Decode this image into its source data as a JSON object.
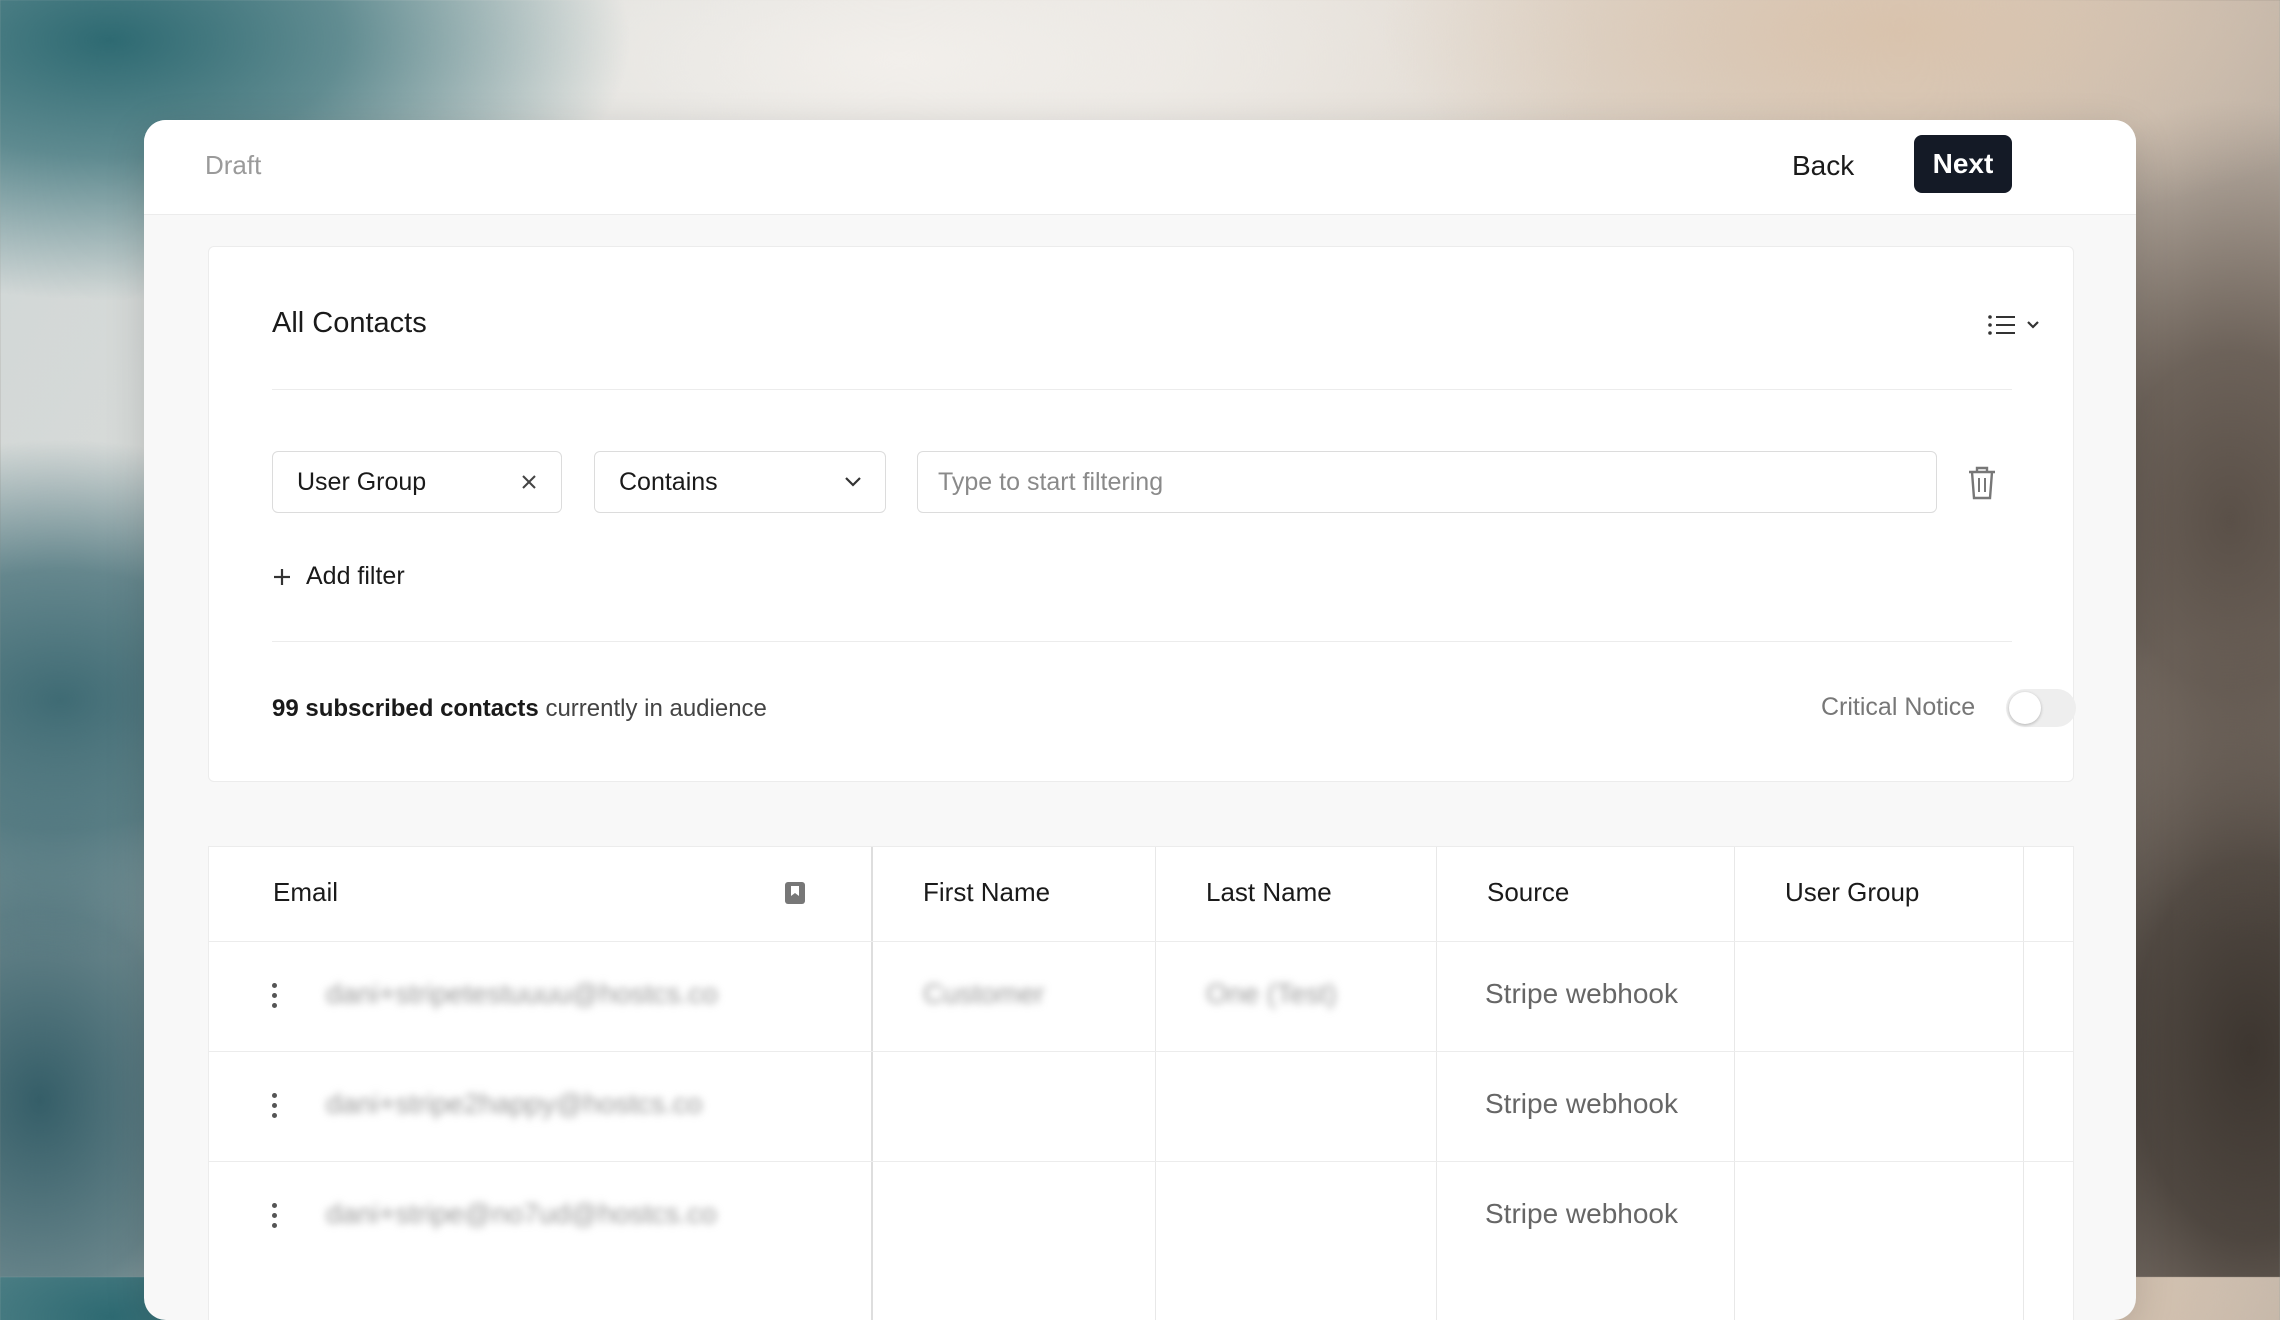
{
  "header": {
    "status": "Draft",
    "back_label": "Back",
    "next_label": "Next"
  },
  "audience": {
    "title": "All Contacts",
    "filter": {
      "field": "User Group",
      "operator": "Contains",
      "value_placeholder": "Type to start filtering"
    },
    "add_filter_label": "Add filter",
    "summary": {
      "count_text": "99 subscribed contacts",
      "suffix_text": "currently in audience"
    },
    "critical_notice_label": "Critical Notice",
    "critical_notice_enabled": false
  },
  "table": {
    "columns": [
      "Email",
      "First Name",
      "Last Name",
      "Source",
      "User Group"
    ],
    "rows": [
      {
        "email": "dani+stripetestuuuu@hostcs.co",
        "first_name": "Customer",
        "last_name": "One (Test)",
        "source": "Stripe webhook",
        "user_group": ""
      },
      {
        "email": "dani+stripe2happy@hostcs.co",
        "first_name": "",
        "last_name": "",
        "source": "Stripe webhook",
        "user_group": ""
      },
      {
        "email": "dani+stripe@no7ud@hostcs.co",
        "first_name": "",
        "last_name": "",
        "source": "Stripe webhook",
        "user_group": ""
      }
    ]
  },
  "colors": {
    "primary_button": "#141a26",
    "toggle_off": "#eeeeee"
  }
}
